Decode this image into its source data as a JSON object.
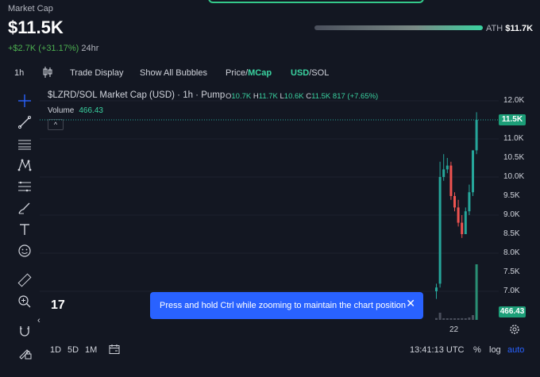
{
  "header": {
    "market_cap_label": "Market Cap",
    "market_cap_value": "$11.5K",
    "change_value": "+$2.7K (+31.17%)",
    "change_period": "24hr",
    "ath_label": "ATH",
    "ath_value": "$11.7K"
  },
  "toolbar": {
    "interval": "1h",
    "trade_display": "Trade Display",
    "show_all_bubbles": "Show All Bubbles",
    "price_label": "Price",
    "separator": "/",
    "mcap_label": "MCap",
    "usd_label": "USD",
    "sol_label": "SOL"
  },
  "chart": {
    "title": "$LZRD/SOL Market Cap (USD) · 1h · Pump",
    "ohlc": {
      "o_label": "O",
      "o": "10.7K",
      "h_label": "H",
      "h": "11.7K",
      "l_label": "L",
      "l": "10.6K",
      "c_label": "C",
      "c": "11.5K",
      "vol": "817",
      "change": "(+7.65%)"
    },
    "volume_label": "Volume",
    "volume_value": "466.43",
    "collapse_glyph": "^",
    "y_ticks": [
      "12.0K",
      "11.5K",
      "11.0K",
      "10.5K",
      "10.0K",
      "9.5K",
      "9.0K",
      "8.5K",
      "8.0K",
      "7.5K",
      "7.0K",
      "466.43"
    ],
    "current_price_tag": "11.5K",
    "volume_tag": "466.43",
    "x_label": "22",
    "colors": {
      "up": "#26a69a",
      "down": "#ef5350",
      "accent": "#3ad2a0",
      "toast": "#2962ff"
    }
  },
  "chart_data": {
    "type": "candlestick",
    "ylim": [
      6.5,
      12.2
    ],
    "y_unit": "K",
    "candles": [
      {
        "o": 7.0,
        "h": 7.2,
        "l": 6.8,
        "c": 7.1
      },
      {
        "o": 7.2,
        "h": 10.4,
        "l": 7.1,
        "c": 10.0
      },
      {
        "o": 10.0,
        "h": 10.6,
        "l": 9.9,
        "c": 10.2
      },
      {
        "o": 10.2,
        "h": 10.5,
        "l": 10.1,
        "c": 10.3
      },
      {
        "o": 10.3,
        "h": 10.4,
        "l": 9.4,
        "c": 9.5
      },
      {
        "o": 9.5,
        "h": 9.6,
        "l": 9.1,
        "c": 9.2
      },
      {
        "o": 9.2,
        "h": 9.4,
        "l": 8.7,
        "c": 8.8
      },
      {
        "o": 8.8,
        "h": 9.0,
        "l": 8.4,
        "c": 8.5
      },
      {
        "o": 8.5,
        "h": 9.2,
        "l": 8.5,
        "c": 9.1
      },
      {
        "o": 9.1,
        "h": 9.8,
        "l": 9.0,
        "c": 9.6
      },
      {
        "o": 9.6,
        "h": 10.7,
        "l": 9.5,
        "c": 10.7
      },
      {
        "o": 10.7,
        "h": 11.7,
        "l": 10.6,
        "c": 11.5
      }
    ],
    "volumes": [
      15,
      60,
      10,
      8,
      12,
      6,
      9,
      14,
      10,
      20,
      40,
      466.43
    ]
  },
  "toast": {
    "message": "Press and hold Ctrl while zooming to maintain the chart position",
    "close_glyph": "✕"
  },
  "bottom": {
    "range_1d": "1D",
    "range_5d": "5D",
    "range_1m": "1M",
    "time": "13:41:13 UTC",
    "percent": "%",
    "log": "log",
    "auto": "auto"
  },
  "misc": {
    "logo_text": "17",
    "nav_arrow": "‹"
  }
}
